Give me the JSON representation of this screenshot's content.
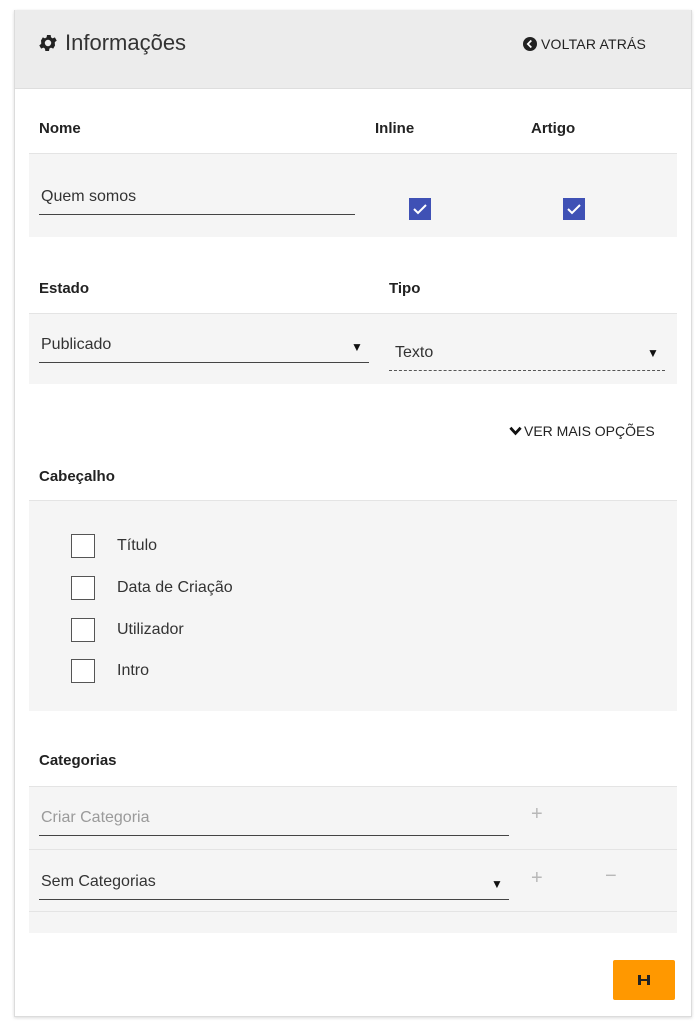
{
  "header": {
    "title": "Informações",
    "back_label": "VOLTAR ATRÁS",
    "title_icon": "gear-icon",
    "back_icon": "circle-arrow-left-icon"
  },
  "columns": {
    "nome": "Nome",
    "inline": "Inline",
    "artigo": "Artigo"
  },
  "row": {
    "nome_value": "Quem somos",
    "inline_checked": true,
    "artigo_checked": true
  },
  "estado": {
    "label": "Estado",
    "value": "Publicado"
  },
  "tipo": {
    "label": "Tipo",
    "value": "Texto"
  },
  "more_options": "VER MAIS OPÇÕES",
  "cabecalho": {
    "label": "Cabeçalho",
    "options": [
      "Título",
      "Data de Criação",
      "Utilizador",
      "Intro"
    ]
  },
  "categorias": {
    "label": "Categorias",
    "create_placeholder": "Criar Categoria",
    "select_value": "Sem Categorias"
  },
  "colors": {
    "accent": "#3f51b5",
    "save": "#ff9800",
    "header_bg": "#ececec",
    "band_bg": "#f5f5f5"
  }
}
